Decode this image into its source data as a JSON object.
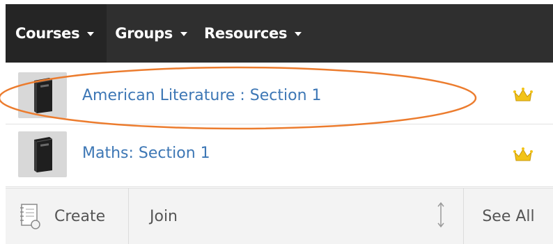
{
  "nav": {
    "items": [
      {
        "label": "Courses"
      },
      {
        "label": "Groups"
      },
      {
        "label": "Resources"
      }
    ]
  },
  "courses": [
    {
      "name": "American Literature : Section 1",
      "owner_icon": "crown-icon"
    },
    {
      "name": "Maths: Section 1",
      "owner_icon": "crown-icon"
    }
  ],
  "footer": {
    "create_label": "Create",
    "join_label": "Join",
    "see_all_label": "See All"
  },
  "colors": {
    "nav_bg": "#2f2f2f",
    "link": "#3d77b5",
    "crown": "#f2c318",
    "highlight": "#ec7c2e"
  }
}
